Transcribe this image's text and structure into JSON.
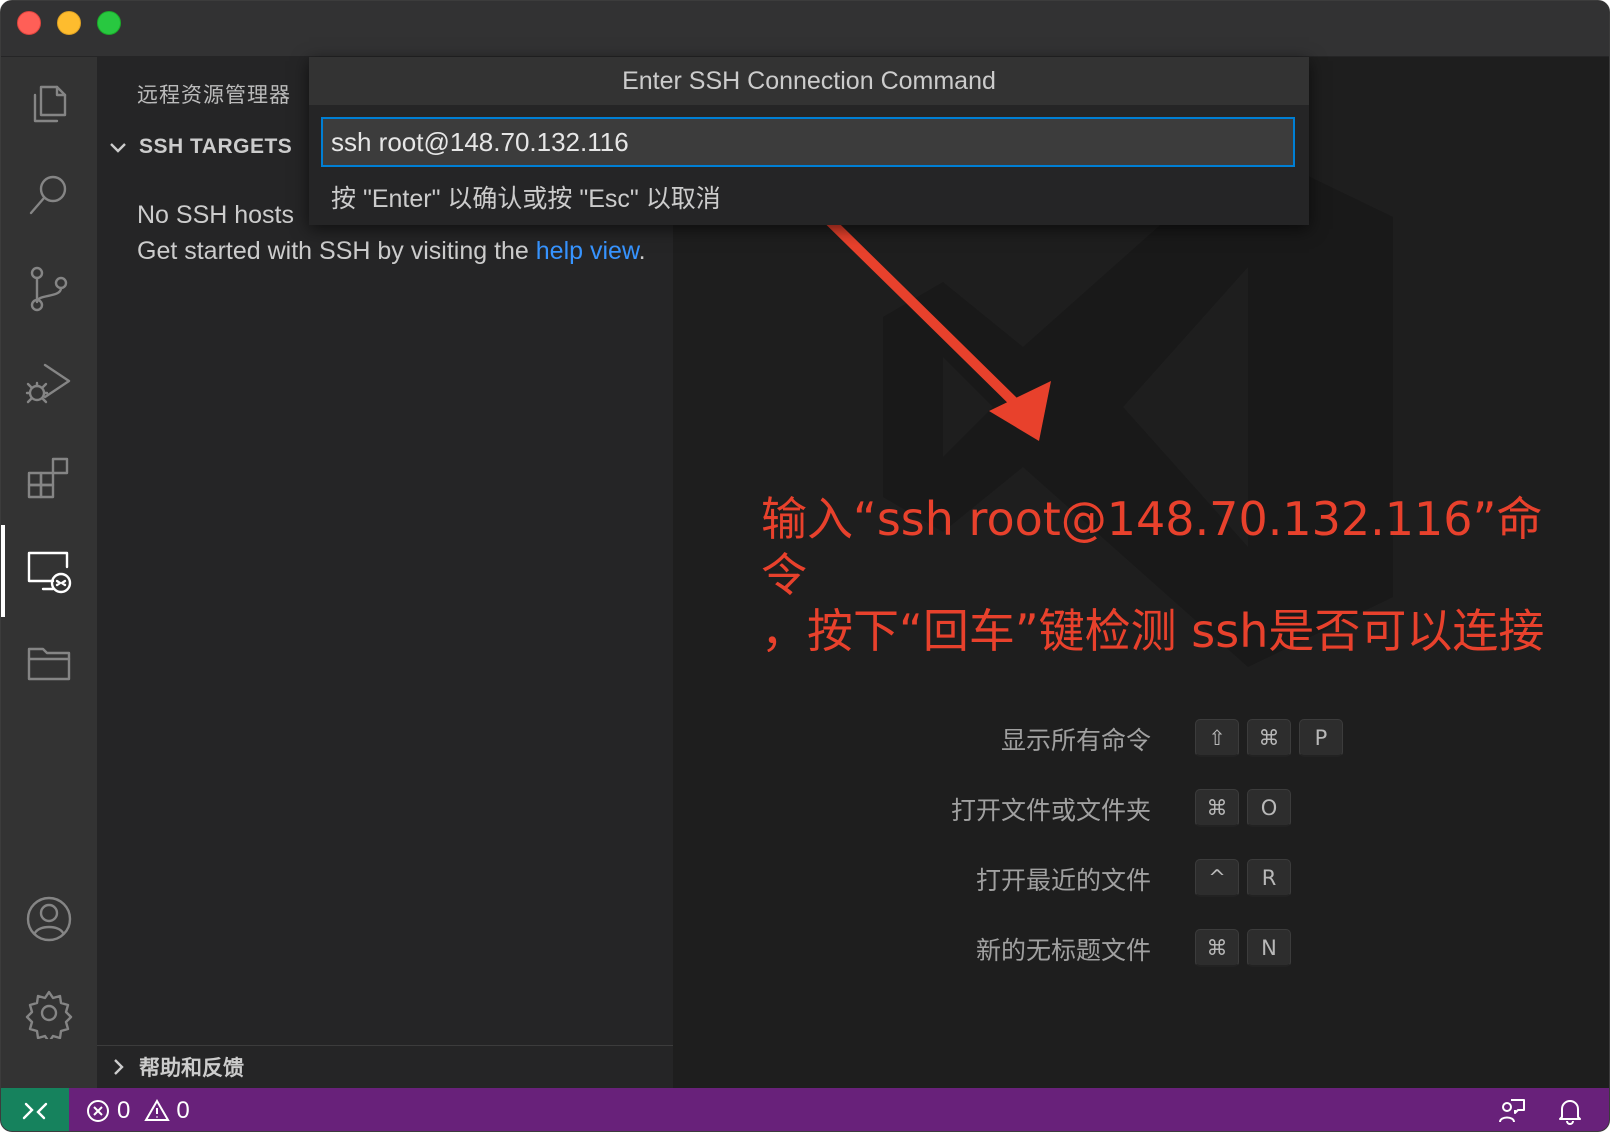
{
  "window": {
    "title_buttons": [
      "close",
      "minimize",
      "maximize"
    ]
  },
  "activity_bar": {
    "items": [
      {
        "icon": "files-icon"
      },
      {
        "icon": "search-icon"
      },
      {
        "icon": "source-control-icon"
      },
      {
        "icon": "run-debug-icon"
      },
      {
        "icon": "extensions-icon"
      },
      {
        "icon": "remote-explorer-icon",
        "active": true
      },
      {
        "icon": "folder-icon"
      }
    ],
    "bottom": [
      {
        "icon": "account-icon"
      },
      {
        "icon": "gear-icon"
      }
    ]
  },
  "sidebar": {
    "title": "远程资源管理器",
    "section_label": "SSH TARGETS",
    "message_before": "No SSH hosts",
    "message_line2": "Get started with SSH by visiting the ",
    "link_text": "help view",
    "message_after": ".",
    "footer_label": "帮助和反馈"
  },
  "quick_pick": {
    "title": "Enter SSH Connection Command",
    "input_value": "ssh root@148.70.132.116",
    "hint": "按 \"Enter\" 以确认或按 \"Esc\" 以取消"
  },
  "annotation": {
    "line1": "输入“ssh root@148.70.132.116”命令",
    "line2": "，按下“回车”键检测 ssh是否可以连接",
    "color": "#e8412c"
  },
  "shortcuts": [
    {
      "label": "显示所有命令",
      "keys": [
        "⇧",
        "⌘",
        "P"
      ]
    },
    {
      "label": "打开文件或文件夹",
      "keys": [
        "⌘",
        "O"
      ]
    },
    {
      "label": "打开最近的文件",
      "keys": [
        "^",
        "R"
      ]
    },
    {
      "label": "新的无标题文件",
      "keys": [
        "⌘",
        "N"
      ]
    }
  ],
  "status_bar": {
    "background": "#68217a",
    "remote_color": "#16825d",
    "errors": "0",
    "warnings": "0"
  }
}
